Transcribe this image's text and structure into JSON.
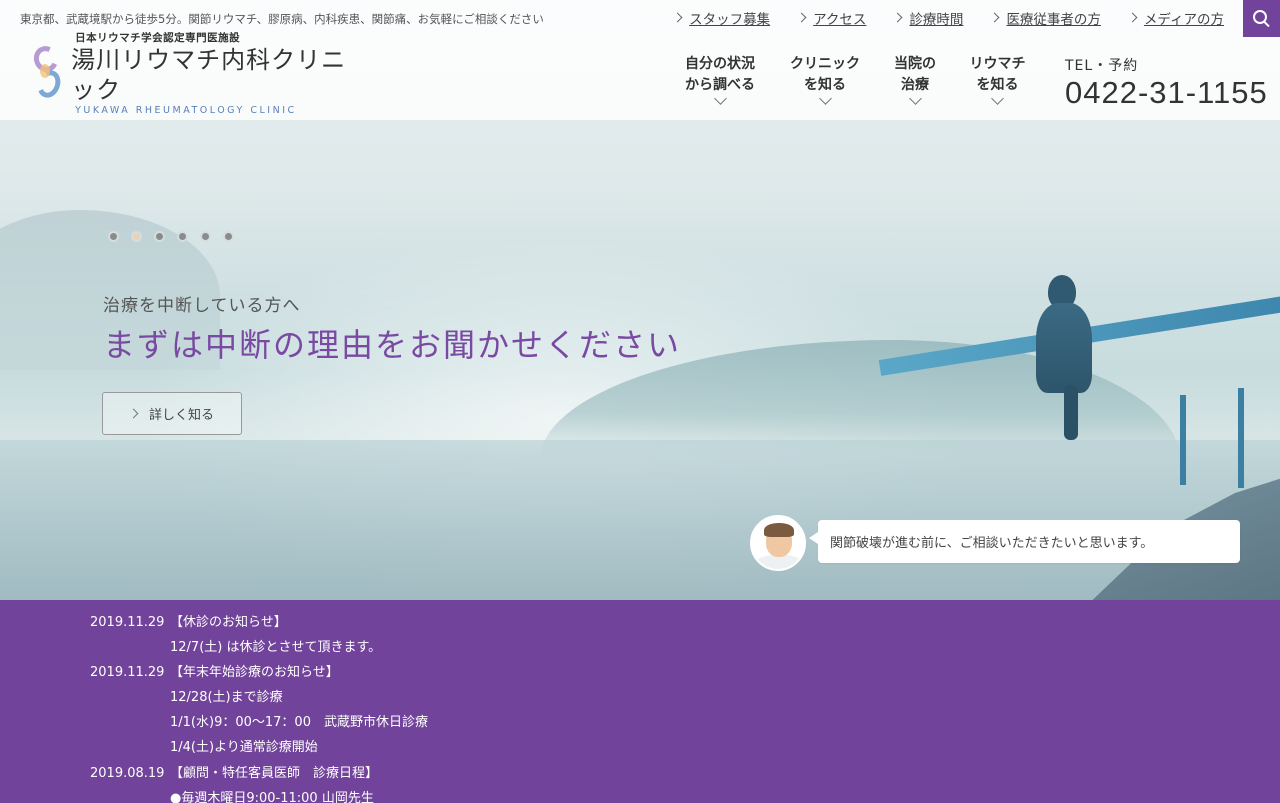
{
  "header": {
    "tagline": "東京都、武蔵境駅から徒歩5分。関節リウマチ、膠原病、内科疾患、関節痛、お気軽にご相談ください",
    "utility_links": [
      "スタッフ募集",
      "アクセス",
      "診療時間",
      "医療従事者の方",
      "メディアの方"
    ],
    "search_icon": "search-icon",
    "logo": {
      "subtitle": "日本リウマチ学会認定専門医施設",
      "name": "湯川リウマチ内科クリニック",
      "english": "YUKAWA RHEUMATOLOGY CLINIC"
    },
    "nav": [
      {
        "line1": "自分の状況",
        "line2": "から調べる"
      },
      {
        "line1": "クリニック",
        "line2": "を知る"
      },
      {
        "line1": "当院の",
        "line2": "治療"
      },
      {
        "line1": "リウマチ",
        "line2": "を知る"
      }
    ],
    "tel": {
      "label": "TEL・予約",
      "number": "0422-31-1155"
    }
  },
  "hero": {
    "slide_count": 6,
    "active_slide": 2,
    "subtitle": "治療を中断している方へ",
    "title": "まずは中断の理由をお聞かせください",
    "button_label": "詳しく知る",
    "speech": "関節破壊が進む前に、ご相談いただきたいと思います。"
  },
  "news": [
    {
      "date": "2019.11.29",
      "lines": [
        "【休診のお知らせ】",
        "12/7(土) は休診とさせて頂きます。"
      ]
    },
    {
      "date": "2019.11.29",
      "lines": [
        "【年末年始診療のお知らせ】",
        "12/28(土)まで診療",
        "1/1(水)9：00〜17：00　武蔵野市休日診療",
        "1/4(土)より通常診療開始"
      ]
    },
    {
      "date": "2019.08.19",
      "lines": [
        "【顧問・特任客員医師　診療日程】",
        "●毎週木曜日9:00-11:00 山岡先生"
      ]
    }
  ],
  "colors": {
    "accent": "#71439a",
    "title": "#7a4aa3"
  }
}
